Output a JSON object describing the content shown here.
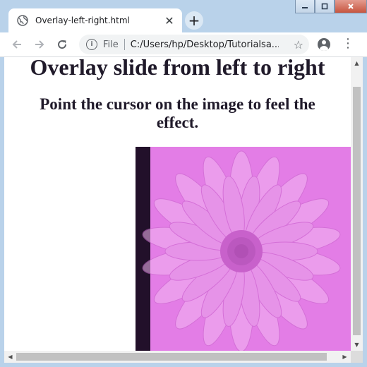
{
  "browser": {
    "tab_title": "Overlay-left-right.html",
    "new_tab_symbol": "+",
    "close_symbol": "✕",
    "address_scheme": "File",
    "address_url": "C:/Users/hp/Desktop/Tutorialsa...",
    "icons": {
      "tab": "globe-icon",
      "back": "back-arrow-icon",
      "forward": "forward-arrow-icon",
      "reload": "reload-icon",
      "site_info": "info-icon",
      "bookmark": "star-icon",
      "profile": "profile-icon",
      "menu": "kebab-menu-icon"
    }
  },
  "page": {
    "heading": "Overlay slide from left to right",
    "subheading": "Point the cursor on the image to feel the effect."
  },
  "image": {
    "subject": "daisy flower",
    "overlay_color": "#e37de6",
    "overlay_progress": 0.93
  },
  "colors": {
    "frame": "#b9d2ea",
    "text": "#201a2a"
  }
}
